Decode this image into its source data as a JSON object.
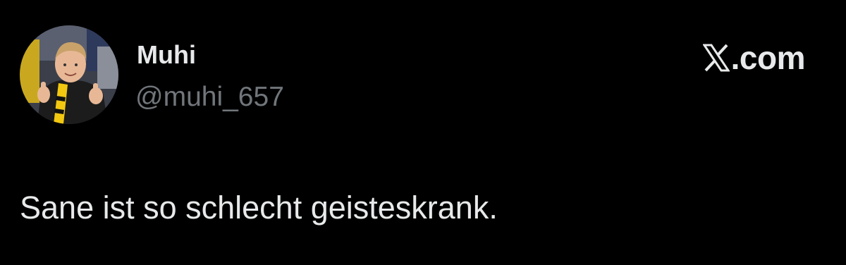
{
  "author": {
    "display_name": "Muhi",
    "handle": "@muhi_657",
    "avatar_icon": "profile-photo"
  },
  "brand": {
    "text": ".com",
    "logo_icon": "x-logo-icon"
  },
  "tweet": {
    "text": "Sane ist so schlecht geisteskrank."
  },
  "colors": {
    "background": "#000000",
    "primary_text": "#e7e9ea",
    "secondary_text": "#71767b"
  }
}
